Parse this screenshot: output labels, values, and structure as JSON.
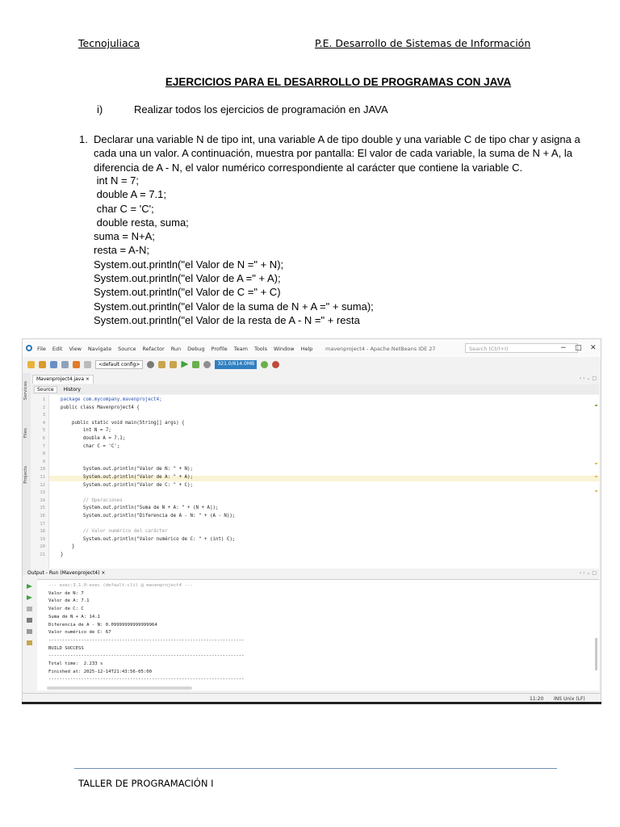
{
  "header": {
    "left": "Tecnojuliaca",
    "right": "P.E. Desarrollo de Sistemas de Información"
  },
  "title": "EJERCICIOS PARA EL DESARROLLO DE PROGRAMAS CON JAVA",
  "instruction": {
    "number": "i)",
    "text": "Realizar todos los ejercicios de programación en JAVA"
  },
  "exercise1": {
    "number": "1.",
    "text": "Declarar una variable N de tipo int, una variable A de tipo double y una variable C de tipo char y asigna a cada una un valor. A continuación, muestra por pantalla: El valor de cada variable, la suma de N + A, la diferencia de A - N, el valor numérico correspondiente al carácter que contiene la variable C.",
    "code": [
      " int N = 7;",
      " double A = 7.1;",
      " char C = 'C';",
      " double resta, suma;",
      "suma = N+A;",
      "resta = A-N;",
      "System.out.println(\"el Valor de N =\" + N);",
      "System.out.println(\"el Valor de A =\" + A);",
      "System.out.println(\"el Valor de C =\" + C)",
      "System.out.println(\"el Valor de la suma de N + A =\" + suma);",
      "System.out.println(\"el Valor de la resta de A - N =\" + resta"
    ]
  },
  "ide": {
    "menus": [
      "File",
      "Edit",
      "View",
      "Navigate",
      "Source",
      "Refactor",
      "Run",
      "Debug",
      "Profile",
      "Team",
      "Tools",
      "Window",
      "Help"
    ],
    "window_title": "mavenproject4 - Apache NetBeans IDE 27",
    "search_placeholder": "Search (Ctrl+I)",
    "config_select": "<default config>",
    "memory": "321.0/614.0MB",
    "side_tabs": [
      "Services",
      "Files",
      "Projects"
    ],
    "editor_tab": "Mavenproject4.java ×",
    "source_tab": "Source",
    "history_tab": "History",
    "code": [
      {
        "n": "1",
        "t": "package com.mycompany.mavenproject4;",
        "k": "kw"
      },
      {
        "n": "2",
        "t": "public class Mavenproject4 {",
        "k": ""
      },
      {
        "n": "3",
        "t": "",
        "k": ""
      },
      {
        "n": "4",
        "t": "    public static void main(String[] args) {",
        "k": ""
      },
      {
        "n": "5",
        "t": "        int N = 7;",
        "k": ""
      },
      {
        "n": "6",
        "t": "        double A = 7.1;",
        "k": ""
      },
      {
        "n": "7",
        "t": "        char C = 'C';",
        "k": ""
      },
      {
        "n": "8",
        "t": "",
        "k": ""
      },
      {
        "n": "9",
        "t": "",
        "k": ""
      },
      {
        "n": "10",
        "t": "        System.out.println(\"Valor de N: \" + N);",
        "k": ""
      },
      {
        "n": "11",
        "t": "        System.out.println(\"Valor de A: \" + A);",
        "k": ""
      },
      {
        "n": "12",
        "t": "        System.out.println(\"Valor de C: \" + C);",
        "k": ""
      },
      {
        "n": "13",
        "t": "",
        "k": ""
      },
      {
        "n": "14",
        "t": "        // Operaciones",
        "k": "cm"
      },
      {
        "n": "15",
        "t": "        System.out.println(\"Suma de N + A: \" + (N + A));",
        "k": ""
      },
      {
        "n": "16",
        "t": "        System.out.println(\"Diferencia de A - N: \" + (A - N));",
        "k": ""
      },
      {
        "n": "17",
        "t": "",
        "k": ""
      },
      {
        "n": "18",
        "t": "        // Valor numérico del carácter",
        "k": "cm"
      },
      {
        "n": "19",
        "t": "        System.out.println(\"Valor numérico de C: \" + (int) C);",
        "k": ""
      },
      {
        "n": "20",
        "t": "    }",
        "k": ""
      },
      {
        "n": "21",
        "t": "}",
        "k": ""
      }
    ],
    "output_tab": "Output - Run (Mavenproject4) ×",
    "output": [
      {
        "t": "--- exec:3.1.0:exec (default-cli) @ mavenproject4 ---",
        "k": "dim"
      },
      {
        "t": "Valor de N: 7",
        "k": ""
      },
      {
        "t": "Valor de A: 7.1",
        "k": ""
      },
      {
        "t": "Valor de C: C",
        "k": ""
      },
      {
        "t": "Suma de N + A: 14.1",
        "k": ""
      },
      {
        "t": "Diferencia de A - N: 0.09999999999999964",
        "k": ""
      },
      {
        "t": "Valor numérico de C: 67",
        "k": ""
      },
      {
        "t": "------------------------------------------------------------------------",
        "k": ""
      },
      {
        "t": "BUILD SUCCESS",
        "k": ""
      },
      {
        "t": "------------------------------------------------------------------------",
        "k": ""
      },
      {
        "t": "Total time:  2.233 s",
        "k": ""
      },
      {
        "t": "Finished at: 2025-12-14T21:43:56-05:00",
        "k": ""
      },
      {
        "t": "------------------------------------------------------------------------",
        "k": ""
      }
    ],
    "status_pos": "11:20",
    "status_mode": "INS Unix (LF)"
  },
  "footer": "TALLER DE PROGRAMACIÓN I"
}
